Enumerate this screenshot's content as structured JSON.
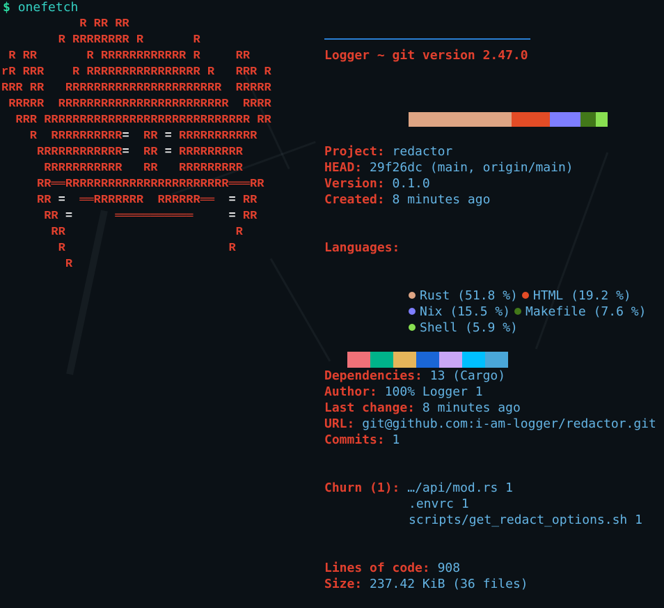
{
  "prompt": {
    "symbol": "$",
    "command": "onefetch"
  },
  "ascii_art": [
    "           R RR RR",
    "        R RRRRRRRR R       R",
    " R RR       R RRRRRRRRRRRR R     RR",
    "rR RRR    R RRRRRRRRRRRRRRRR R   RRR R",
    "RRR RR   RRRRRRRRRRRRRRRRRRRRRR  RRRRR",
    " RRRRR  RRRRRRRRRRRRRRRRRRRRRRRR  RRRR",
    "  RRR RRRRRRRRRRRRRRRRRRRRRRRRRRRRR RR",
    "    R  RRRRRRRRRR=  RR = RRRRRRRRRRR",
    "     RRRRRRRRRRRR=  RR = RRRRRRRRR",
    "      RRRRRRRRRRR   RR   RRRRRRRRR",
    "     RR══RRRRRRRRRRRRRRRRRRRRRRR═══RR",
    "     RR =  ══RRRRRRR  RRRRRR══  = RR",
    "      RR =      ═══════════     = RR",
    "       RR                        R",
    "        R                       R",
    "         R"
  ],
  "info": {
    "title": "Logger ~ git version 2.47.0",
    "fields": [
      {
        "key": "Project",
        "value": "redactor"
      },
      {
        "key": "HEAD",
        "value": "29f26dc (main, origin/main)"
      },
      {
        "key": "Version",
        "value": "0.1.0"
      },
      {
        "key": "Created",
        "value": "8 minutes ago"
      }
    ],
    "languages_label": "Languages",
    "languages": [
      {
        "name": "Rust",
        "pct": 51.8,
        "label": "Rust (51.8 %)",
        "color": "#dea584"
      },
      {
        "name": "HTML",
        "pct": 19.2,
        "label": "HTML (19.2 %)",
        "color": "#e34c26"
      },
      {
        "name": "Nix",
        "pct": 15.5,
        "label": "Nix (15.5 %)",
        "color": "#7e7eff"
      },
      {
        "name": "Makefile",
        "pct": 7.6,
        "label": "Makefile (7.6 %)",
        "color": "#427819"
      },
      {
        "name": "Shell",
        "pct": 5.9,
        "label": "Shell (5.9 %)",
        "color": "#89e051"
      }
    ],
    "fields2": [
      {
        "key": "Dependencies",
        "value": "13 (Cargo)"
      },
      {
        "key": "Author",
        "value": "100% Logger 1"
      },
      {
        "key": "Last change",
        "value": "8 minutes ago"
      },
      {
        "key": "URL",
        "value": "git@github.com:i-am-logger/redactor.git"
      },
      {
        "key": "Commits",
        "value": "1"
      }
    ],
    "churn": {
      "key": "Churn (1)",
      "items": [
        "…/api/mod.rs 1",
        ".envrc 1",
        "scripts/get_redact_options.sh 1"
      ]
    },
    "fields3": [
      {
        "key": "Lines of code",
        "value": "908"
      },
      {
        "key": "Size",
        "value": "237.42 KiB (36 files)"
      }
    ]
  },
  "palette": [
    "#f07178",
    "#00b38a",
    "#e5b55a",
    "#1a66d6",
    "#c9a6f5",
    "#00bfff",
    "#4aa7d9"
  ]
}
